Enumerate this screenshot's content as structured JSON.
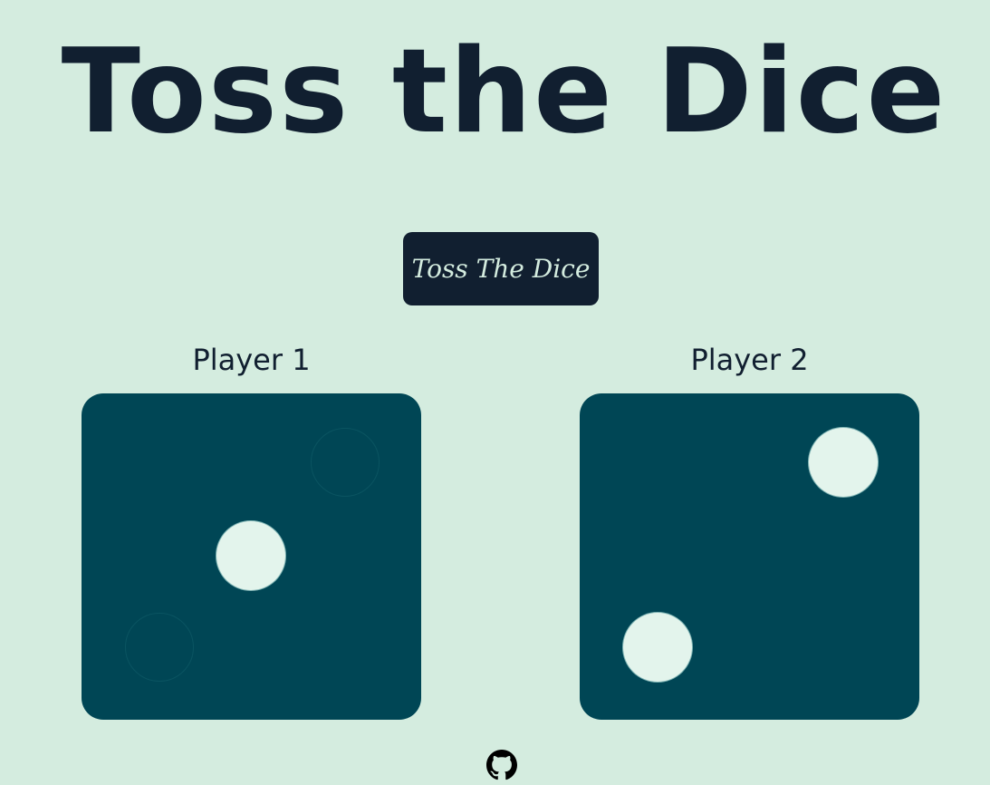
{
  "header": {
    "title": "Toss the Dice"
  },
  "controls": {
    "toss_button_label": "Toss The Dice"
  },
  "players": [
    {
      "label": "Player 1",
      "die_value": 3
    },
    {
      "label": "Player 2",
      "die_value": 2
    }
  ],
  "footer": {
    "link_icon": "github-icon"
  },
  "colors": {
    "background": "#d4ecdf",
    "text": "#111f30",
    "die_face": "#004655",
    "pip": "#e3f4ec"
  }
}
